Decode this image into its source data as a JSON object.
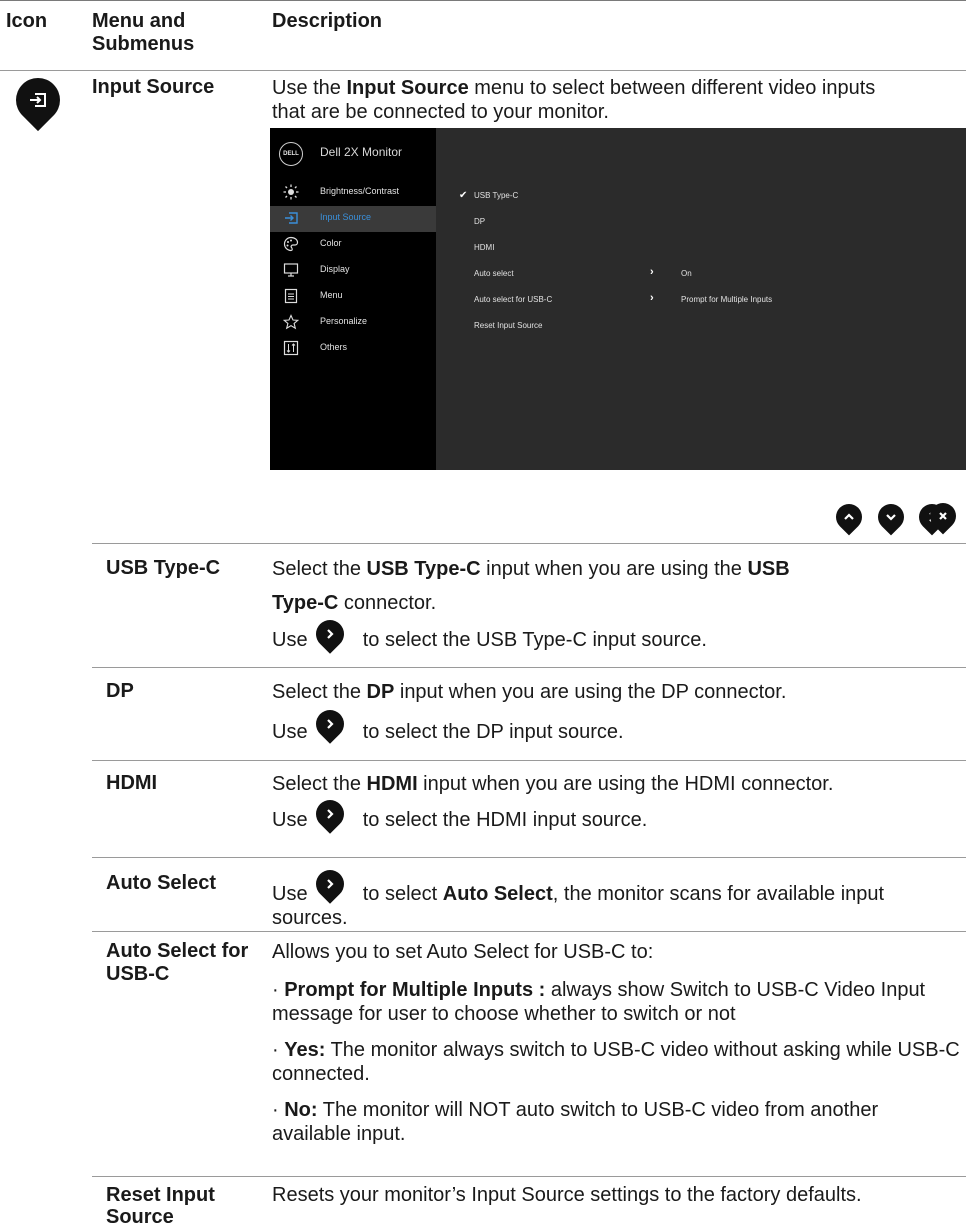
{
  "header": {
    "col_icon": "Icon",
    "col_menu": "Menu and Submenus",
    "col_desc": "Description"
  },
  "input_source": {
    "name": "Input Source",
    "desc_pre": "Use the ",
    "desc_bold": "Input Source",
    "desc_post": " menu to select between different video inputs that are be connected to your monitor."
  },
  "osd": {
    "logo": "DELL",
    "title": "Dell 2X Monitor",
    "menu": [
      {
        "label": "Brightness/Contrast",
        "icon": "brightness-icon"
      },
      {
        "label": "Input Source",
        "icon": "input-source-icon"
      },
      {
        "label": "Color",
        "icon": "color-palette-icon"
      },
      {
        "label": "Display",
        "icon": "display-icon"
      },
      {
        "label": "Menu",
        "icon": "menu-icon"
      },
      {
        "label": "Personalize",
        "icon": "star-icon"
      },
      {
        "label": "Others",
        "icon": "others-icon"
      }
    ],
    "options": [
      "USB Type-C",
      "DP",
      "HDMI",
      "Auto select",
      "Auto select for USB-C",
      "Reset Input Source"
    ],
    "auto_select_value": "On",
    "auto_select_usbc_value": "Prompt for Multiple Inputs",
    "accent": "#3a8fd9"
  },
  "nav_buttons": [
    "up-icon",
    "down-icon",
    "right-icon",
    "close-icon"
  ],
  "rows": [
    {
      "name": "USB Type-C",
      "line1_pre": "Select the ",
      "line1_bold": "USB Type-C",
      "line1_mid": " input when you are using the ",
      "line1_bold2": "USB",
      "line2_bold": "Type-C",
      "line2_post": " connector.",
      "use_pre": "Use",
      "use_post": "to select the USB Type-C input source."
    },
    {
      "name": "DP",
      "line1_pre": "Select the ",
      "line1_bold": "DP",
      "line1_post": " input when you are using the DP connector.",
      "use_pre": "Use",
      "use_post": "to select the DP input source."
    },
    {
      "name": "HDMI",
      "line1_pre": "Select the ",
      "line1_bold": "HDMI",
      "line1_post": " input when you are using the HDMI connector.",
      "use_pre": "Use",
      "use_post": "to select the HDMI input source."
    },
    {
      "name": "Auto Select",
      "use_pre": "Use",
      "use_mid": "to select ",
      "bold": "Auto Select",
      "post": ", the monitor scans for available input sources."
    },
    {
      "name": "Auto Select for USB-C",
      "intro": "Allows you to set Auto Select for USB-C to:",
      "b1_bold": "Prompt for Multiple Inputs :",
      "b1_text": " always show Switch to USB-C Video Input message for user to choose whether to switch or not",
      "b2_bold": "Yes:",
      "b2_text": " The monitor always switch to USB-C video without asking while USB-C connected.",
      "b3_bold": "No:",
      "b3_text": " The monitor  will NOT auto switch to USB-C video from another available input."
    },
    {
      "name": "Reset Input Source",
      "text": "Resets your monitor’s Input Source settings to the factory defaults."
    }
  ]
}
